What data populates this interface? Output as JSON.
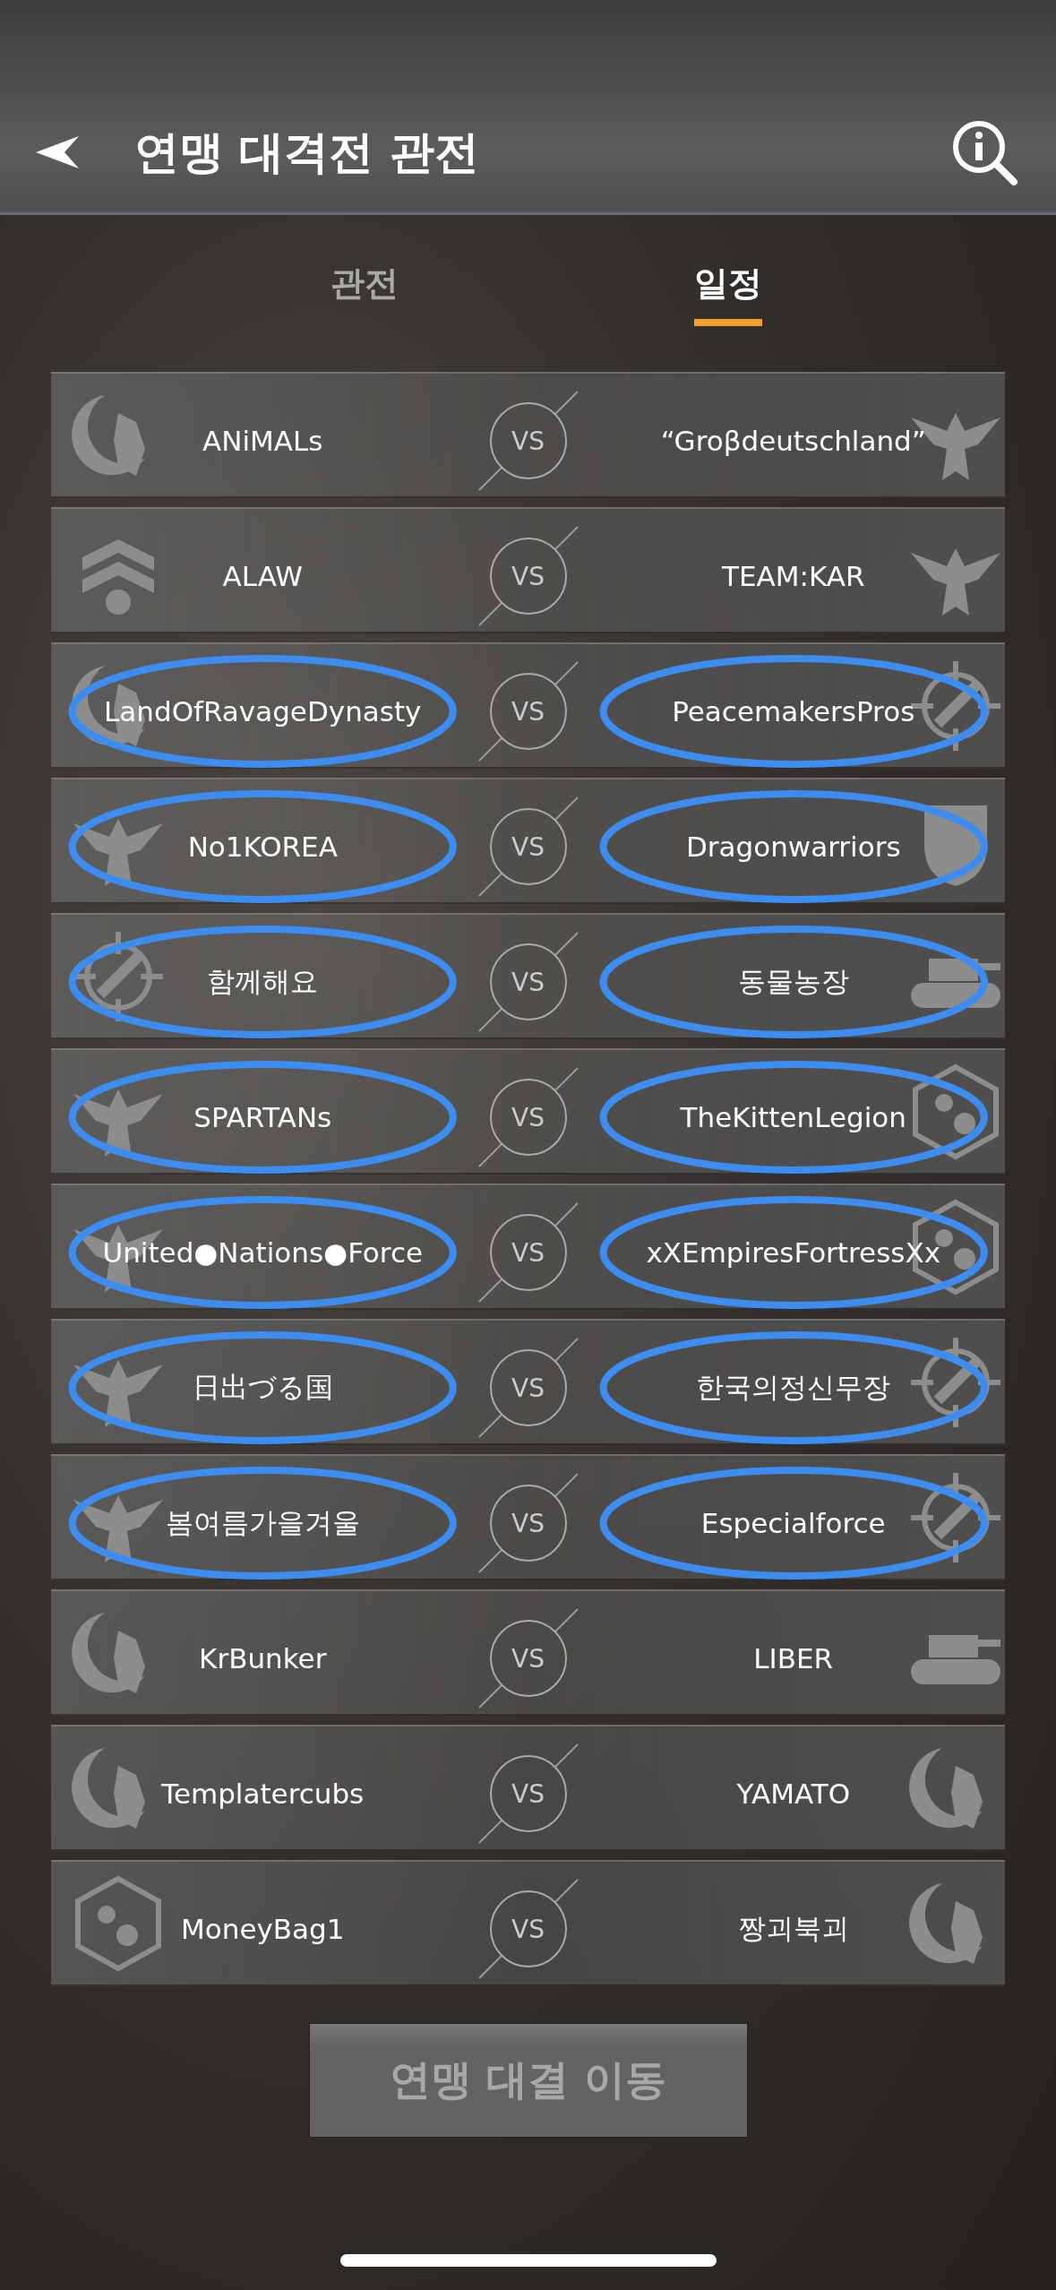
{
  "header": {
    "title": "연맹 대격전 관전"
  },
  "tabs": [
    {
      "label": "관전",
      "selected": false
    },
    {
      "label": "일정",
      "selected": true
    }
  ],
  "matches": [
    {
      "left": {
        "name": "ANiMALs",
        "circled": false
      },
      "vs": "VS",
      "right": {
        "name": "“Groβdeutschland”",
        "circled": false
      }
    },
    {
      "left": {
        "name": "ALAW",
        "circled": false
      },
      "vs": "VS",
      "right": {
        "name": "TEAM:KAR",
        "circled": false
      }
    },
    {
      "left": {
        "name": "LandOfRavageDynasty",
        "circled": true
      },
      "vs": "VS",
      "right": {
        "name": "PeacemakersPros",
        "circled": true
      }
    },
    {
      "left": {
        "name": "No1KOREA",
        "circled": true
      },
      "vs": "VS",
      "right": {
        "name": "Dragonwarriors",
        "circled": true
      }
    },
    {
      "left": {
        "name": "함께해요",
        "circled": true
      },
      "vs": "VS",
      "right": {
        "name": "동물농장",
        "circled": true
      }
    },
    {
      "left": {
        "name": "SPARTANs",
        "circled": true
      },
      "vs": "VS",
      "right": {
        "name": "TheKittenLegion",
        "circled": true
      }
    },
    {
      "left": {
        "name": "United●Nations●Force",
        "circled": true
      },
      "vs": "VS",
      "right": {
        "name": "xXEmpiresFortressXx",
        "circled": true
      }
    },
    {
      "left": {
        "name": "日出づる国",
        "circled": true
      },
      "vs": "VS",
      "right": {
        "name": "한국의정신무장",
        "circled": true
      }
    },
    {
      "left": {
        "name": "봄여름가을겨울",
        "circled": true
      },
      "vs": "VS",
      "right": {
        "name": "Especialforce",
        "circled": true
      }
    },
    {
      "left": {
        "name": "KrBunker",
        "circled": false
      },
      "vs": "VS",
      "right": {
        "name": "LIBER",
        "circled": false
      }
    },
    {
      "left": {
        "name": "Templatercubs",
        "circled": false
      },
      "vs": "VS",
      "right": {
        "name": "YAMATO",
        "circled": false
      }
    },
    {
      "left": {
        "name": "MoneyBag1",
        "circled": false
      },
      "vs": "VS",
      "right": {
        "name": "짱괴북괴",
        "circled": false
      }
    }
  ],
  "action_button": {
    "label": "연맹 대결 이동",
    "disabled": true
  }
}
